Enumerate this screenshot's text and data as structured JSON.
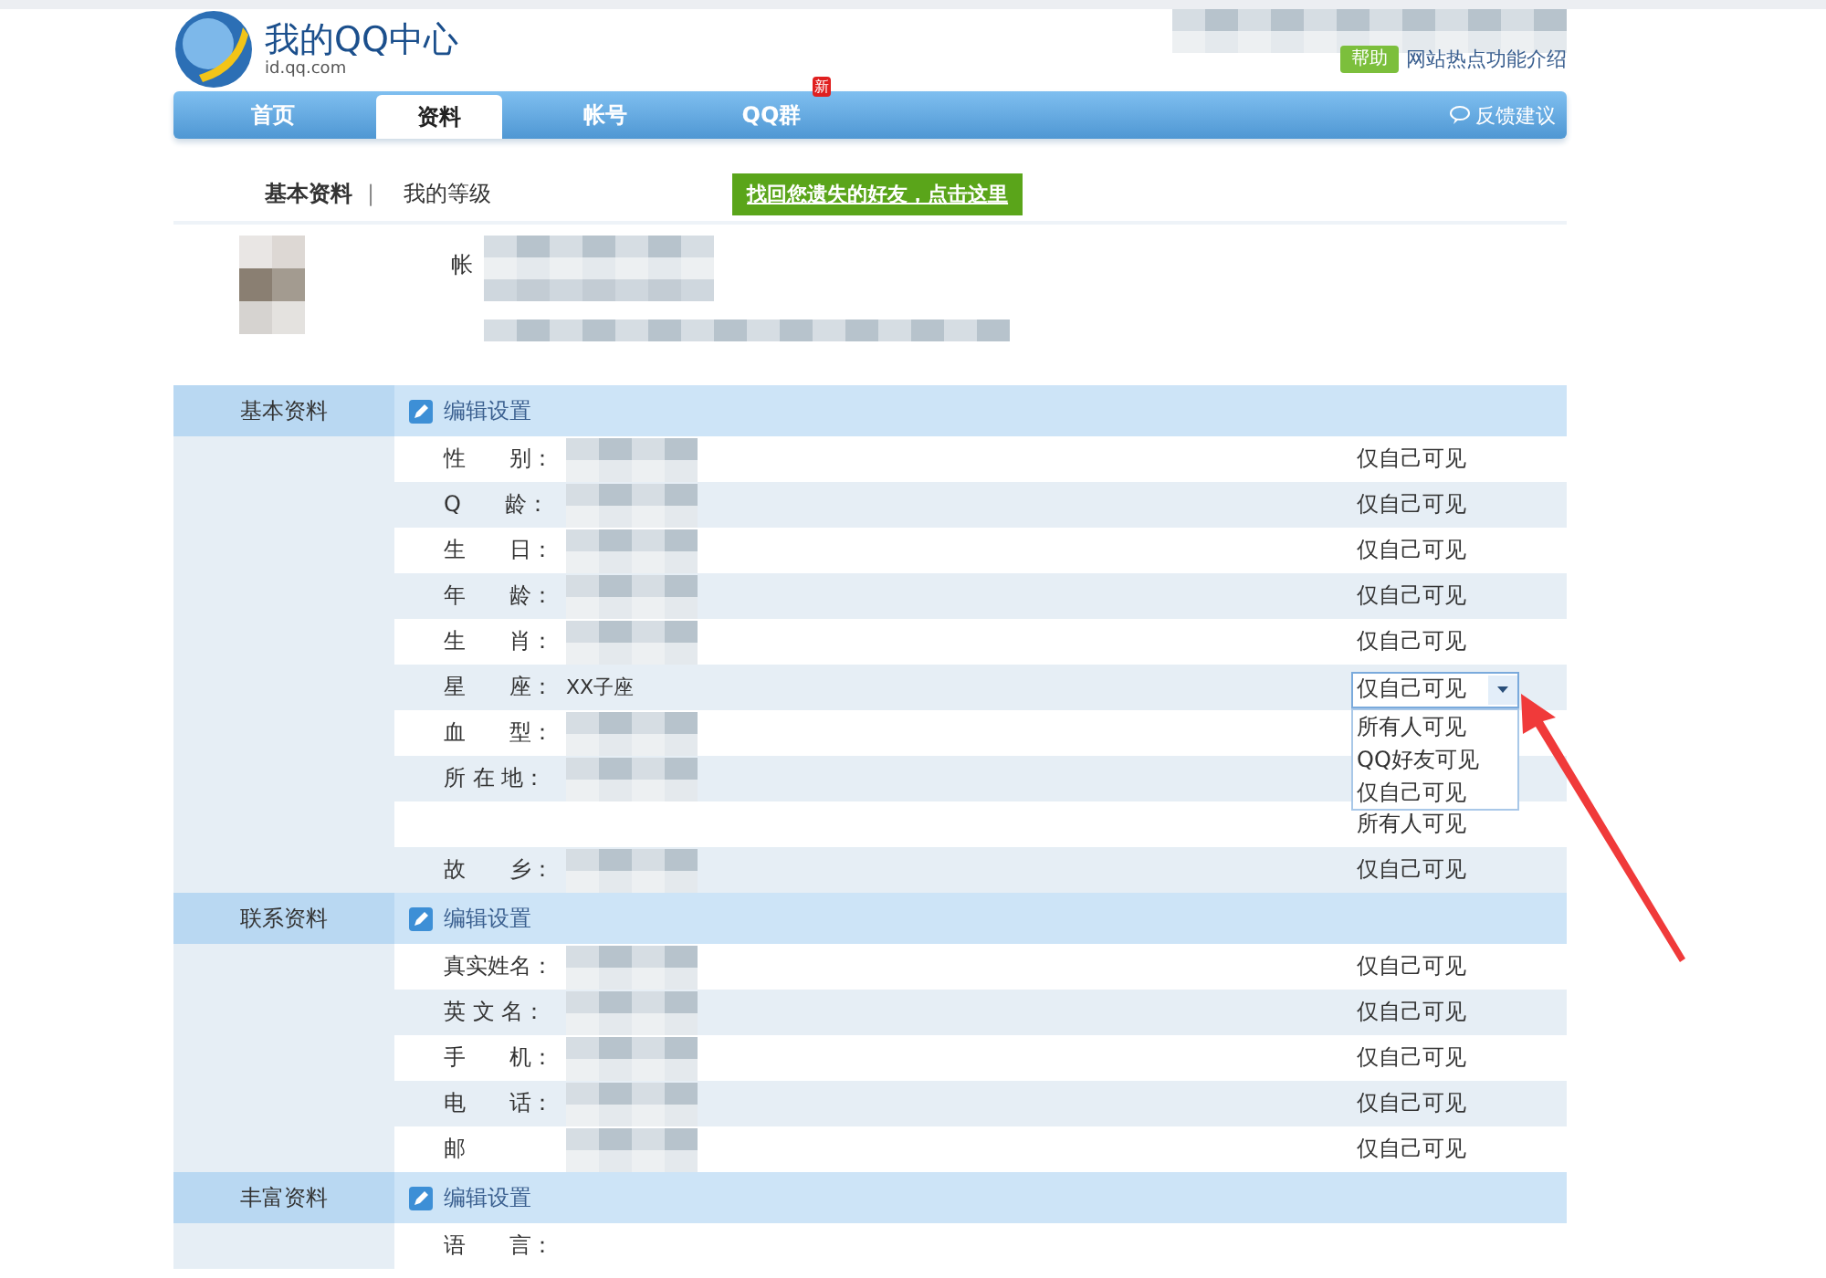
{
  "header": {
    "logo_title": "我的QQ中心",
    "logo_subtitle": "id.qq.com",
    "help_badge": "帮助",
    "news_link": "网站热点功能介绍"
  },
  "nav": {
    "tabs": [
      {
        "label": "首页",
        "selected": false
      },
      {
        "label": "资料",
        "selected": true
      },
      {
        "label": "帐号",
        "selected": false
      },
      {
        "label": "QQ群",
        "selected": false,
        "badge": "新"
      }
    ],
    "feedback": "反馈建议"
  },
  "subnav": {
    "items": [
      {
        "label": "基本资料",
        "selected": true
      },
      {
        "label": "我的等级",
        "selected": false
      }
    ],
    "separator": "|",
    "banner_link": "找回您遗失的好友，点击这里"
  },
  "profile": {
    "account_label": "帐"
  },
  "sections": [
    {
      "title": "基本资料",
      "edit": "编辑设置",
      "rows": [
        {
          "label": "性　　别：",
          "redacted": true,
          "visibility": "仅自己可见"
        },
        {
          "label": "Q　　龄：",
          "redacted": true,
          "visibility": "仅自己可见"
        },
        {
          "label": "生　　日：",
          "redacted": true,
          "visibility": "仅自己可见"
        },
        {
          "label": "年　　龄：",
          "redacted": true,
          "visibility": "仅自己可见"
        },
        {
          "label": "生　　肖：",
          "redacted": true,
          "visibility": "仅自己可见"
        },
        {
          "label": "星　　座：",
          "value": "XX子座",
          "redacted": false,
          "dropdown": {
            "value": "仅自己可见",
            "options": [
              "所有人可见",
              "QQ好友可见",
              "仅自己可见"
            ]
          }
        },
        {
          "label": "血　　型：",
          "redacted": true
        },
        {
          "label": "所 在 地：",
          "redacted": true
        },
        {
          "redacted": false,
          "visibility": "所有人可见"
        },
        {
          "label": "故　　乡：",
          "redacted": true,
          "visibility": "仅自己可见"
        }
      ]
    },
    {
      "title": "联系资料",
      "edit": "编辑设置",
      "rows": [
        {
          "label": "真实姓名：",
          "redacted": true,
          "visibility": "仅自己可见"
        },
        {
          "label": "英 文 名：",
          "redacted": true,
          "visibility": "仅自己可见"
        },
        {
          "label": "手　　机：",
          "redacted": true,
          "visibility": "仅自己可见"
        },
        {
          "label": "电　　话：",
          "redacted": true,
          "visibility": "仅自己可见"
        },
        {
          "label": "邮",
          "redacted": true,
          "visibility": "仅自己可见"
        }
      ]
    },
    {
      "title": "丰富资料",
      "edit": "编辑设置",
      "rows": [
        {
          "label": "语　　言：",
          "redacted": false
        }
      ]
    }
  ]
}
